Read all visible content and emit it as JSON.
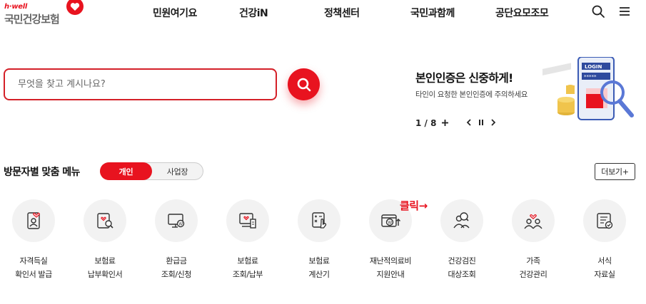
{
  "logo": {
    "sub": "h·well",
    "main": "국민건강보험"
  },
  "nav": {
    "items": [
      "민원여기요",
      "건강iN",
      "정책센터",
      "국민과함께",
      "공단요모조모"
    ]
  },
  "header_icons": [
    "search-icon",
    "hamburger-menu-icon"
  ],
  "search": {
    "placeholder": "무엇을 찾고 계시나요?",
    "button_icon": "search-icon"
  },
  "banner": {
    "title": "본인인증은 신중하게!",
    "subtitle": "타인이 요청한 본인인증에 주의하세요",
    "art_text": "LOGIN",
    "pager": {
      "current": "1",
      "total": "8",
      "count_text": "1 / 8"
    }
  },
  "visitor_menu": {
    "title": "방문자별 맞춤 메뉴",
    "toggle": {
      "selected": "개인",
      "other": "사업장"
    },
    "more_label": "더보기+"
  },
  "annotation": "클릭→",
  "menu_items": [
    {
      "label": "자격득실\n확인서 발급",
      "icon": "id-card-heart-icon"
    },
    {
      "label": "보험료\n납부확인서",
      "icon": "document-search-icon"
    },
    {
      "label": "환급금\n조회/신청",
      "icon": "monitor-coin-icon"
    },
    {
      "label": "보험료\n조회/납부",
      "icon": "receipt-heart-icon"
    },
    {
      "label": "보험료\n계산기",
      "icon": "calculator-hand-icon"
    },
    {
      "label": "재난적의료비\n지원안내",
      "icon": "wallet-coin-arrow-icon"
    },
    {
      "label": "건강검진\n대상조회",
      "icon": "people-search-icon"
    },
    {
      "label": "가족\n건강관리",
      "icon": "family-heart-icon"
    },
    {
      "label": "서식\n자료실",
      "icon": "form-document-icon"
    }
  ],
  "colors": {
    "brand": "#e8131f",
    "text": "#222222",
    "icon_bg": "#f2f2f2"
  }
}
